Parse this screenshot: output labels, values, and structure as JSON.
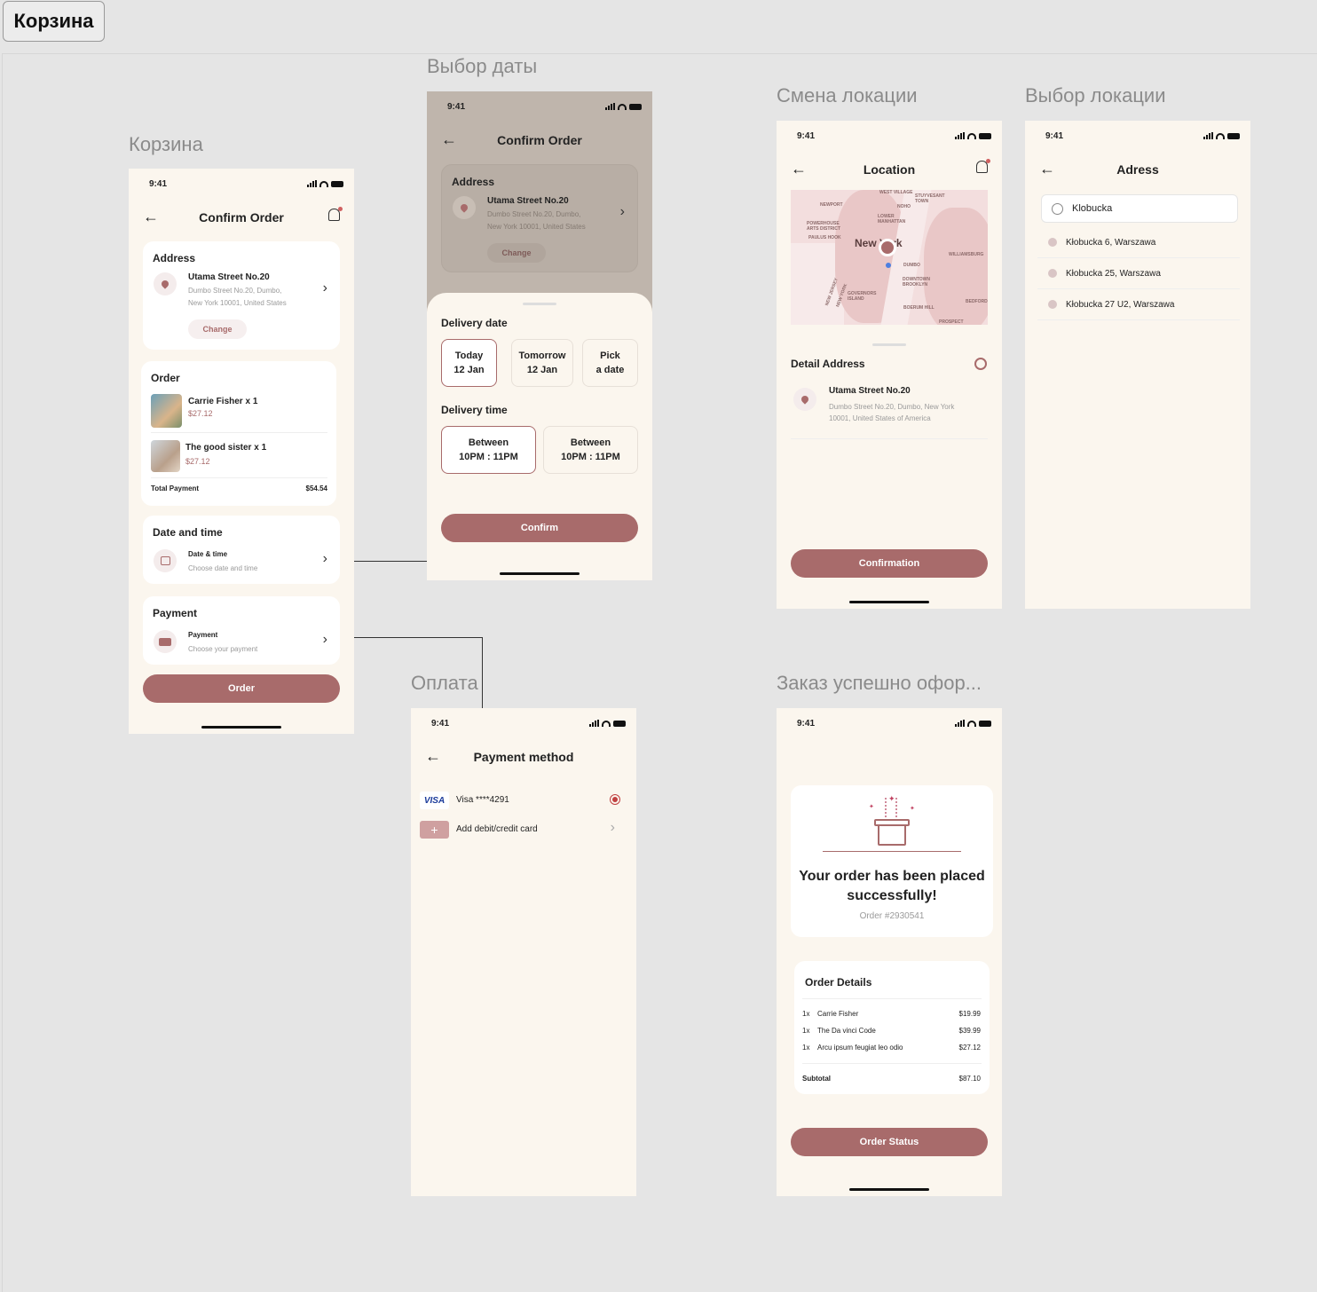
{
  "page_tab": "Корзина",
  "labels": {
    "cart": "Корзина",
    "date": "Выбор даты",
    "change_location": "Смена локации",
    "choose_location": "Выбор локации",
    "payment": "Оплата",
    "success": "Заказ успешно офор..."
  },
  "status_time": "9:41",
  "cart": {
    "title": "Confirm Order",
    "address_title": "Address",
    "street": "Utama Street No.20",
    "address_line1": "Dumbo Street No.20, Dumbo,",
    "address_line2": "New York 10001, United States",
    "change": "Change",
    "order_title": "Order",
    "items": [
      {
        "name": "Carrie Fisher x 1",
        "price": "$27.12"
      },
      {
        "name": "The good sister x 1",
        "price": "$27.12"
      }
    ],
    "total_label": "Total Payment",
    "total_value": "$54.54",
    "datetime_title": "Date and time",
    "datetime_label": "Date & time",
    "datetime_hint": "Choose date and time",
    "payment_title": "Payment",
    "payment_label": "Payment",
    "payment_hint": "Choose your payment",
    "order_button": "Order"
  },
  "date": {
    "title": "Confirm Order",
    "address_title": "Address",
    "street": "Utama Street No.20",
    "address_line1": "Dumbo Street No.20, Dumbo,",
    "address_line2": "New York 10001, United States",
    "change": "Change",
    "delivery_date": "Delivery date",
    "dates": [
      {
        "l1": "Today",
        "l2": "12 Jan"
      },
      {
        "l1": "Tomorrow",
        "l2": "12 Jan"
      },
      {
        "l1": "Pick",
        "l2": "a date"
      }
    ],
    "delivery_time": "Delivery time",
    "times": [
      {
        "l1": "Between",
        "l2": "10PM : 11PM"
      },
      {
        "l1": "Between",
        "l2": "10PM : 11PM"
      }
    ],
    "confirm": "Confirm"
  },
  "location": {
    "title": "Location",
    "map_city": "New York",
    "map_labels": [
      "NEWPORT",
      "POWERHOUSE ARTS DISTRICT",
      "PAULUS HOOK",
      "NOHO",
      "LOWER MANHATTAN",
      "STUYVESANT TOWN",
      "WILLIAMSBURG",
      "DUMBO",
      "DOWNTOWN BROOKLYN",
      "GOVERNORS ISLAND",
      "BOERUM HILL",
      "BEDFORD",
      "PROSPECT",
      "NEW JERSEY",
      "NEW YORK",
      "WEST VILLAGE"
    ],
    "detail_title": "Detail Address",
    "street": "Utama Street No.20",
    "address_line1": "Dumbo Street No.20, Dumbo, New York",
    "address_line2": "10001, United States of America",
    "button": "Confirmation"
  },
  "adress": {
    "title": "Adress",
    "search_value": "Klobucka",
    "results": [
      "Kłobucka 6, Warszawa",
      "Kłobucka 25, Warszawa",
      "Kłobucka 27 U2, Warszawa"
    ]
  },
  "payment": {
    "title": "Payment method",
    "visa_brand": "VISA",
    "visa_label": "Visa ****4291",
    "add_card": "Add debit/credit card"
  },
  "success": {
    "headline": "Your order has been placed successfully!",
    "order_no": "Order #2930541",
    "details_title": "Order Details",
    "lines": [
      {
        "qty": "1x",
        "name": "Carrie Fisher",
        "price": "$19.99"
      },
      {
        "qty": "1x",
        "name": "The Da vinci Code",
        "price": "$39.99"
      },
      {
        "qty": "1x",
        "name": "Arcu ipsum feugiat leo odio",
        "price": "$27.12"
      }
    ],
    "subtotal_label": "Subtotal",
    "subtotal_value": "$87.10",
    "button": "Order Status"
  },
  "colors": {
    "accent": "#a86b6b",
    "background": "#fbf6ee",
    "canvas": "#e5e5e5"
  }
}
